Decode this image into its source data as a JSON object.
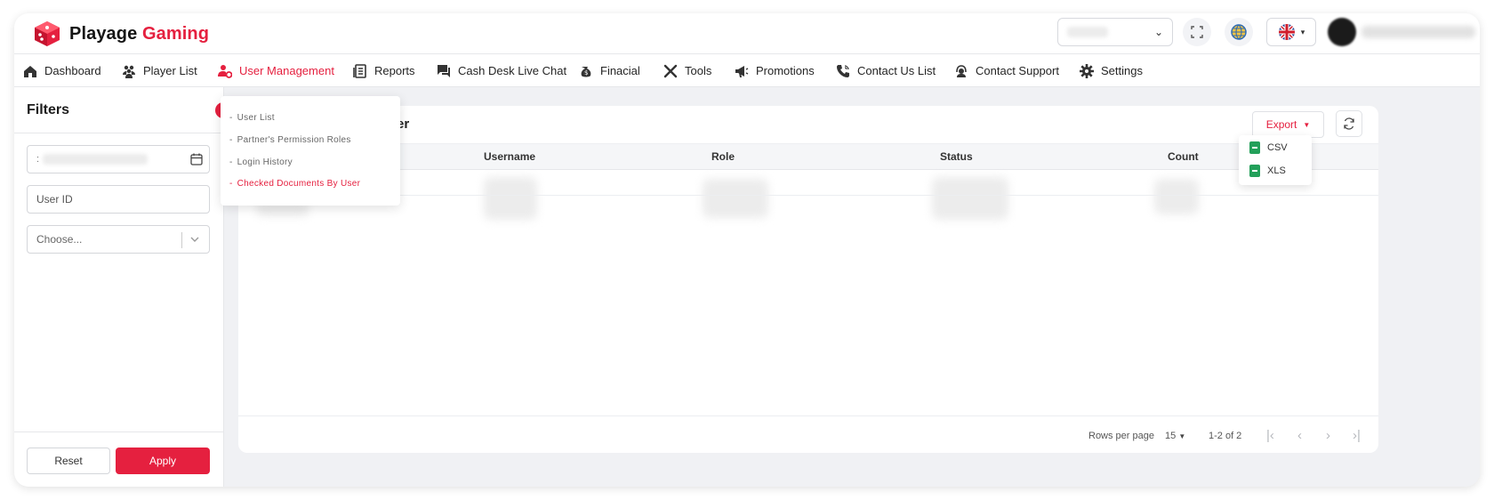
{
  "brand": {
    "name_part1": "Playage",
    "name_part2": "Gaming",
    "accent": "#e5203f"
  },
  "topbar": {
    "select_icon": "chevron-down-icon",
    "fullscreen_icon": "fullscreen-icon",
    "globe_icon": "globe-icon",
    "language_flag": "uk-flag-icon"
  },
  "nav": {
    "items": [
      {
        "label": "Dashboard",
        "icon": "home-icon"
      },
      {
        "label": "Player List",
        "icon": "users-icon"
      },
      {
        "label": "User Management",
        "icon": "user-management-icon",
        "active": true
      },
      {
        "label": "Reports",
        "icon": "reports-icon"
      },
      {
        "label": "Cash Desk Live Chat",
        "icon": "chat-icon"
      },
      {
        "label": "Finacial",
        "icon": "financial-icon"
      },
      {
        "label": "Tools",
        "icon": "tools-icon"
      },
      {
        "label": "Promotions",
        "icon": "megaphone-icon"
      },
      {
        "label": "Contact Us List",
        "icon": "phone-icon"
      },
      {
        "label": "Contact Support",
        "icon": "support-icon"
      },
      {
        "label": "Settings",
        "icon": "gear-icon"
      }
    ]
  },
  "user_management_menu": {
    "items": [
      {
        "label": "User List"
      },
      {
        "label": "Partner's Permission Roles"
      },
      {
        "label": "Login History"
      },
      {
        "label": "Checked Documents By User",
        "active": true
      }
    ]
  },
  "filters": {
    "title": "Filters",
    "user_id_placeholder": "User ID",
    "choose_placeholder": "Choose...",
    "reset_label": "Reset",
    "apply_label": "Apply"
  },
  "main": {
    "title_fragment": "er",
    "export_label": "Export",
    "export_options": [
      "CSV",
      "XLS"
    ],
    "columns": [
      "Username",
      "Role",
      "Status",
      "Count"
    ],
    "rows_per_page_label": "Rows per page",
    "rows_per_page_value": "15",
    "range_text": "1-2 of 2"
  }
}
